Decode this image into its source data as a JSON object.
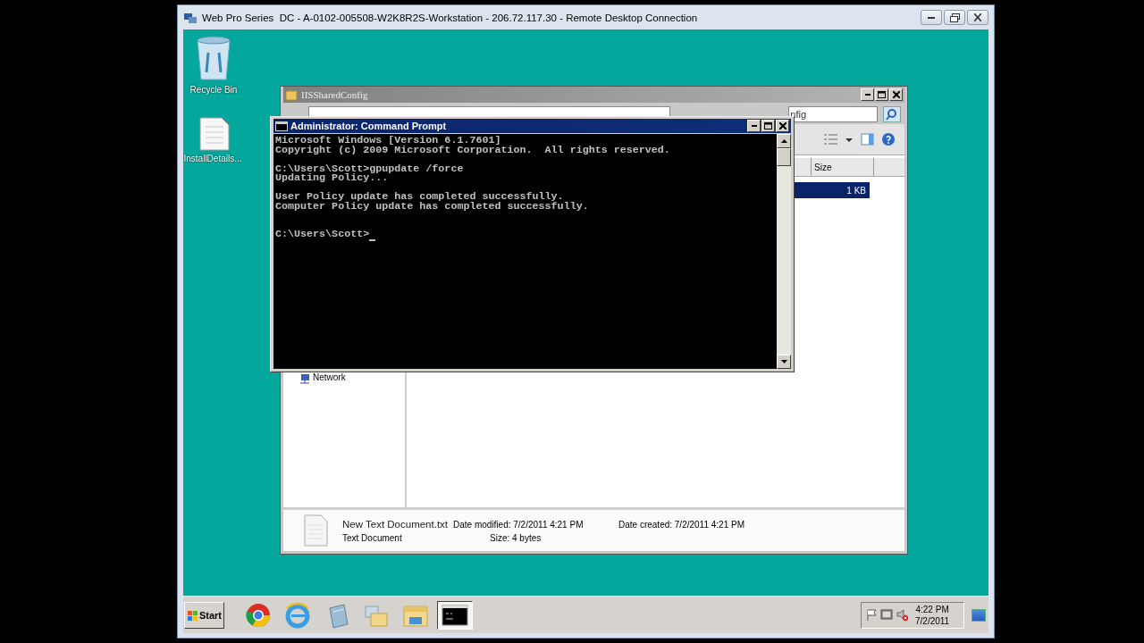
{
  "remote_window": {
    "title": "Web Pro Series  DC - A-0102-005508-W2K8R2S-Workstation - 206.72.117.30 - Remote Desktop Connection"
  },
  "desktop_icons": [
    {
      "label": "Recycle Bin",
      "kind": "recycle-bin"
    },
    {
      "label": "InstallDetails...",
      "kind": "document"
    }
  ],
  "explorer": {
    "title": "IISSharedConfig",
    "search": {
      "placeholder": "nfig"
    },
    "columns": [
      "Size"
    ],
    "rows": [
      {
        "size": "1 KB",
        "selected": true
      }
    ],
    "nav": [
      "Network"
    ],
    "details": {
      "name": "New Text Document.txt",
      "modified": "Date modified: 7/2/2011 4:21 PM",
      "created": "Date created: 7/2/2011 4:21 PM",
      "type": "Text Document",
      "size": "Size: 4 bytes"
    }
  },
  "console": {
    "title": "Administrator: Command Prompt",
    "output": "Microsoft Windows [Version 6.1.7601]\nCopyright (c) 2009 Microsoft Corporation.  All rights reserved.\n\nC:\\Users\\Scott>gpupdate /force\nUpdating Policy...\n\nUser Policy update has completed successfully.\nComputer Policy update has completed successfully.\n\n\nC:\\Users\\Scott>"
  },
  "taskbar": {
    "start": "Start",
    "apps": [
      {
        "kind": "chrome",
        "selected": false
      },
      {
        "kind": "ie",
        "selected": false
      },
      {
        "kind": "notepad",
        "selected": false
      },
      {
        "kind": "folders",
        "selected": false
      },
      {
        "kind": "explorer",
        "selected": false
      },
      {
        "kind": "console",
        "selected": true
      }
    ],
    "clock": {
      "time": "4:22 PM",
      "date": "7/2/2011"
    }
  }
}
